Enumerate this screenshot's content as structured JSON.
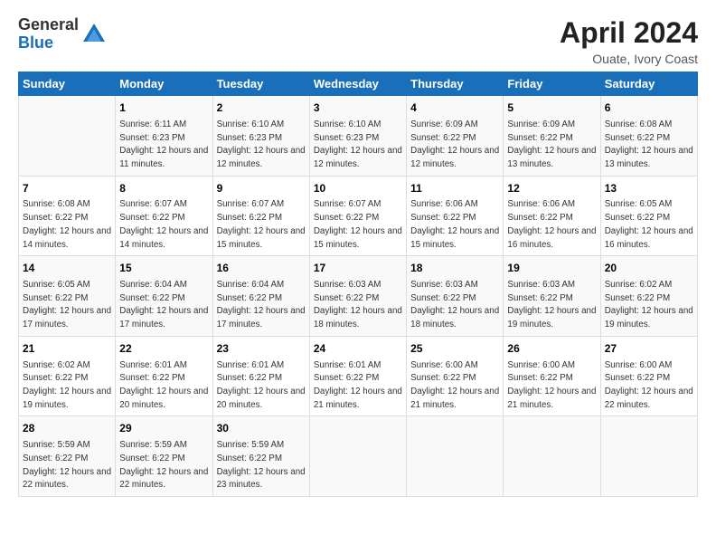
{
  "logo": {
    "general": "General",
    "blue": "Blue"
  },
  "title": "April 2024",
  "subtitle": "Ouate, Ivory Coast",
  "headers": [
    "Sunday",
    "Monday",
    "Tuesday",
    "Wednesday",
    "Thursday",
    "Friday",
    "Saturday"
  ],
  "weeks": [
    [
      {
        "day": "",
        "sunrise": "",
        "sunset": "",
        "daylight": ""
      },
      {
        "day": "1",
        "sunrise": "Sunrise: 6:11 AM",
        "sunset": "Sunset: 6:23 PM",
        "daylight": "Daylight: 12 hours and 11 minutes."
      },
      {
        "day": "2",
        "sunrise": "Sunrise: 6:10 AM",
        "sunset": "Sunset: 6:23 PM",
        "daylight": "Daylight: 12 hours and 12 minutes."
      },
      {
        "day": "3",
        "sunrise": "Sunrise: 6:10 AM",
        "sunset": "Sunset: 6:23 PM",
        "daylight": "Daylight: 12 hours and 12 minutes."
      },
      {
        "day": "4",
        "sunrise": "Sunrise: 6:09 AM",
        "sunset": "Sunset: 6:22 PM",
        "daylight": "Daylight: 12 hours and 12 minutes."
      },
      {
        "day": "5",
        "sunrise": "Sunrise: 6:09 AM",
        "sunset": "Sunset: 6:22 PM",
        "daylight": "Daylight: 12 hours and 13 minutes."
      },
      {
        "day": "6",
        "sunrise": "Sunrise: 6:08 AM",
        "sunset": "Sunset: 6:22 PM",
        "daylight": "Daylight: 12 hours and 13 minutes."
      }
    ],
    [
      {
        "day": "7",
        "sunrise": "Sunrise: 6:08 AM",
        "sunset": "Sunset: 6:22 PM",
        "daylight": "Daylight: 12 hours and 14 minutes."
      },
      {
        "day": "8",
        "sunrise": "Sunrise: 6:07 AM",
        "sunset": "Sunset: 6:22 PM",
        "daylight": "Daylight: 12 hours and 14 minutes."
      },
      {
        "day": "9",
        "sunrise": "Sunrise: 6:07 AM",
        "sunset": "Sunset: 6:22 PM",
        "daylight": "Daylight: 12 hours and 15 minutes."
      },
      {
        "day": "10",
        "sunrise": "Sunrise: 6:07 AM",
        "sunset": "Sunset: 6:22 PM",
        "daylight": "Daylight: 12 hours and 15 minutes."
      },
      {
        "day": "11",
        "sunrise": "Sunrise: 6:06 AM",
        "sunset": "Sunset: 6:22 PM",
        "daylight": "Daylight: 12 hours and 15 minutes."
      },
      {
        "day": "12",
        "sunrise": "Sunrise: 6:06 AM",
        "sunset": "Sunset: 6:22 PM",
        "daylight": "Daylight: 12 hours and 16 minutes."
      },
      {
        "day": "13",
        "sunrise": "Sunrise: 6:05 AM",
        "sunset": "Sunset: 6:22 PM",
        "daylight": "Daylight: 12 hours and 16 minutes."
      }
    ],
    [
      {
        "day": "14",
        "sunrise": "Sunrise: 6:05 AM",
        "sunset": "Sunset: 6:22 PM",
        "daylight": "Daylight: 12 hours and 17 minutes."
      },
      {
        "day": "15",
        "sunrise": "Sunrise: 6:04 AM",
        "sunset": "Sunset: 6:22 PM",
        "daylight": "Daylight: 12 hours and 17 minutes."
      },
      {
        "day": "16",
        "sunrise": "Sunrise: 6:04 AM",
        "sunset": "Sunset: 6:22 PM",
        "daylight": "Daylight: 12 hours and 17 minutes."
      },
      {
        "day": "17",
        "sunrise": "Sunrise: 6:03 AM",
        "sunset": "Sunset: 6:22 PM",
        "daylight": "Daylight: 12 hours and 18 minutes."
      },
      {
        "day": "18",
        "sunrise": "Sunrise: 6:03 AM",
        "sunset": "Sunset: 6:22 PM",
        "daylight": "Daylight: 12 hours and 18 minutes."
      },
      {
        "day": "19",
        "sunrise": "Sunrise: 6:03 AM",
        "sunset": "Sunset: 6:22 PM",
        "daylight": "Daylight: 12 hours and 19 minutes."
      },
      {
        "day": "20",
        "sunrise": "Sunrise: 6:02 AM",
        "sunset": "Sunset: 6:22 PM",
        "daylight": "Daylight: 12 hours and 19 minutes."
      }
    ],
    [
      {
        "day": "21",
        "sunrise": "Sunrise: 6:02 AM",
        "sunset": "Sunset: 6:22 PM",
        "daylight": "Daylight: 12 hours and 19 minutes."
      },
      {
        "day": "22",
        "sunrise": "Sunrise: 6:01 AM",
        "sunset": "Sunset: 6:22 PM",
        "daylight": "Daylight: 12 hours and 20 minutes."
      },
      {
        "day": "23",
        "sunrise": "Sunrise: 6:01 AM",
        "sunset": "Sunset: 6:22 PM",
        "daylight": "Daylight: 12 hours and 20 minutes."
      },
      {
        "day": "24",
        "sunrise": "Sunrise: 6:01 AM",
        "sunset": "Sunset: 6:22 PM",
        "daylight": "Daylight: 12 hours and 21 minutes."
      },
      {
        "day": "25",
        "sunrise": "Sunrise: 6:00 AM",
        "sunset": "Sunset: 6:22 PM",
        "daylight": "Daylight: 12 hours and 21 minutes."
      },
      {
        "day": "26",
        "sunrise": "Sunrise: 6:00 AM",
        "sunset": "Sunset: 6:22 PM",
        "daylight": "Daylight: 12 hours and 21 minutes."
      },
      {
        "day": "27",
        "sunrise": "Sunrise: 6:00 AM",
        "sunset": "Sunset: 6:22 PM",
        "daylight": "Daylight: 12 hours and 22 minutes."
      }
    ],
    [
      {
        "day": "28",
        "sunrise": "Sunrise: 5:59 AM",
        "sunset": "Sunset: 6:22 PM",
        "daylight": "Daylight: 12 hours and 22 minutes."
      },
      {
        "day": "29",
        "sunrise": "Sunrise: 5:59 AM",
        "sunset": "Sunset: 6:22 PM",
        "daylight": "Daylight: 12 hours and 22 minutes."
      },
      {
        "day": "30",
        "sunrise": "Sunrise: 5:59 AM",
        "sunset": "Sunset: 6:22 PM",
        "daylight": "Daylight: 12 hours and 23 minutes."
      },
      {
        "day": "",
        "sunrise": "",
        "sunset": "",
        "daylight": ""
      },
      {
        "day": "",
        "sunrise": "",
        "sunset": "",
        "daylight": ""
      },
      {
        "day": "",
        "sunrise": "",
        "sunset": "",
        "daylight": ""
      },
      {
        "day": "",
        "sunrise": "",
        "sunset": "",
        "daylight": ""
      }
    ]
  ]
}
